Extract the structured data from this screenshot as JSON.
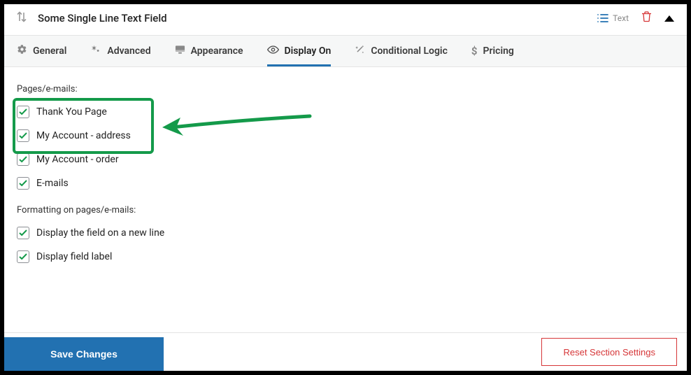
{
  "header": {
    "title": "Some Single Line Text Field",
    "type_label": "Text"
  },
  "tabs": {
    "general": "General",
    "advanced": "Advanced",
    "appearance": "Appearance",
    "display_on": "Display On",
    "conditional": "Conditional Logic",
    "pricing": "Pricing"
  },
  "sections": {
    "pages_label": "Pages/e-mails:",
    "formatting_label": "Formatting on pages/e-mails:"
  },
  "options": {
    "thank_you": "Thank You Page",
    "account_address": "My Account - address",
    "account_order": "My Account - order",
    "emails": "E-mails",
    "new_line": "Display the field on a new line",
    "field_label": "Display field label"
  },
  "footer": {
    "save": "Save Changes",
    "reset": "Reset Section Settings"
  },
  "colors": {
    "accent": "#2271b1",
    "success": "#149a4a",
    "danger": "#d63638"
  }
}
